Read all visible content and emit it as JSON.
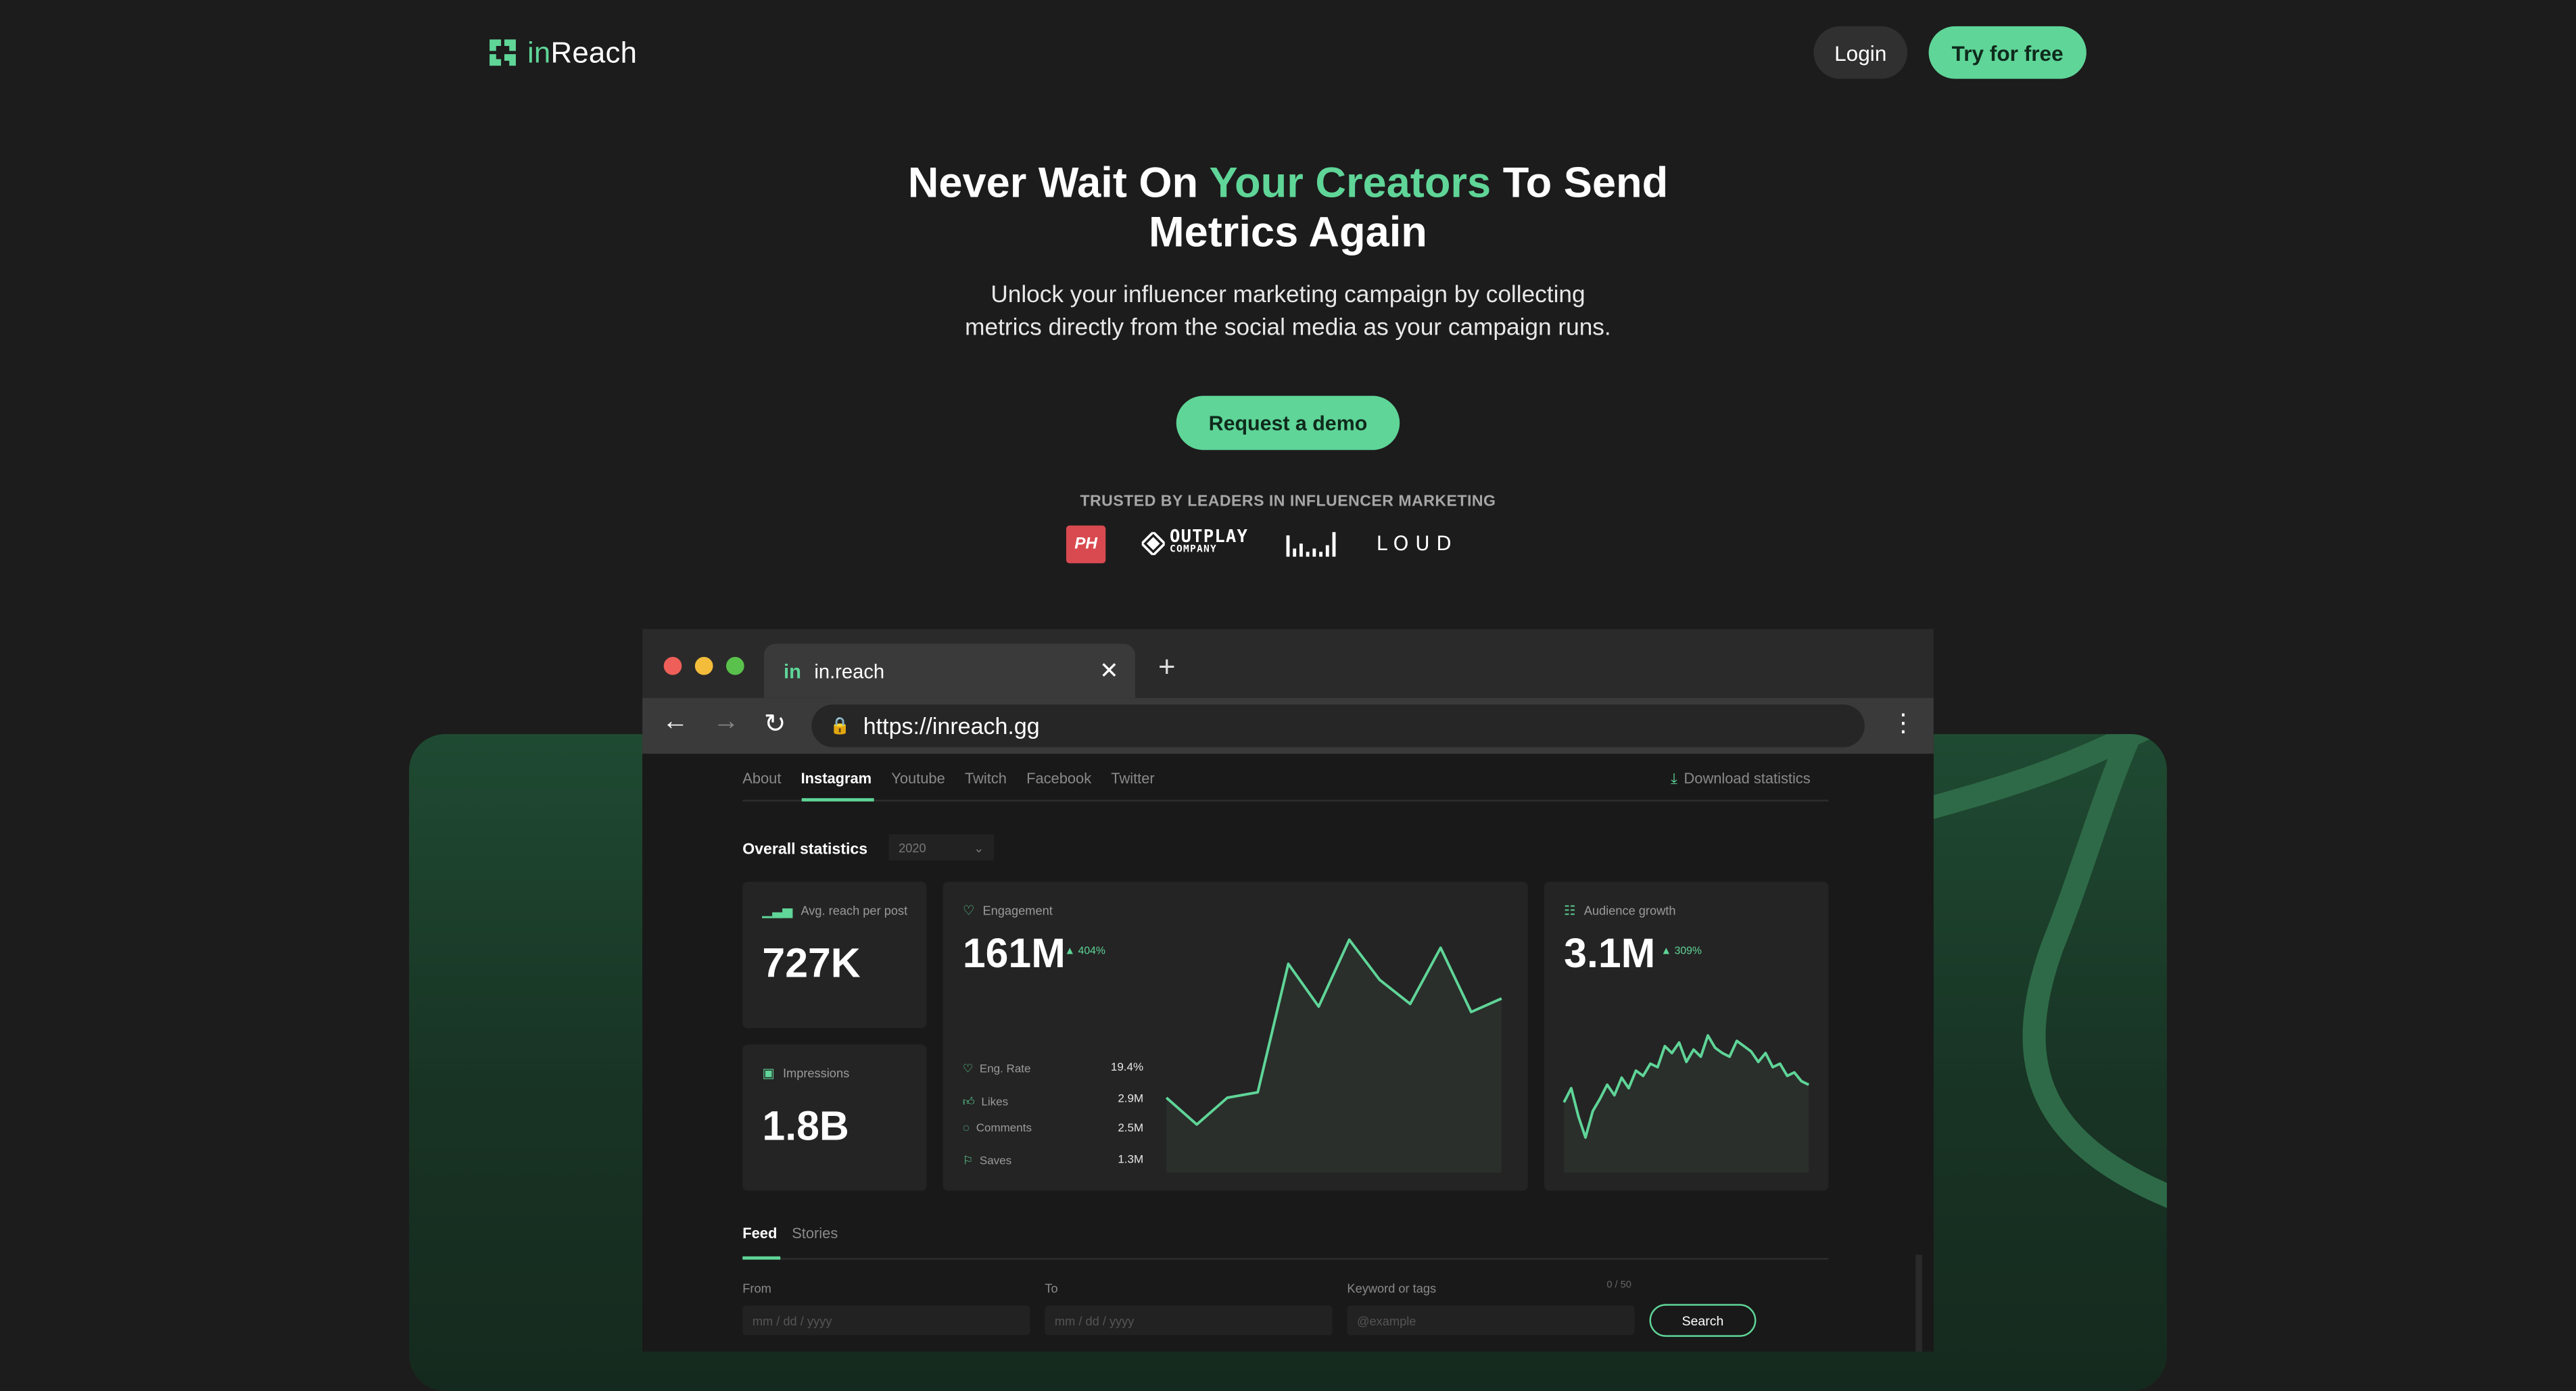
{
  "header": {
    "logo_text_prefix": "in",
    "logo_text_suffix": "Reach",
    "login_label": "Login",
    "try_label": "Try for free"
  },
  "hero": {
    "title_part1": "Never Wait On ",
    "title_accent": "Your Creators",
    "title_part2": " To Send Metrics Again",
    "subtitle": "Unlock your influencer marketing campaign by collecting metrics directly from the social media as your campaign runs.",
    "cta_label": "Request a demo",
    "trusted_label": "TRUSTED BY LEADERS IN INFLUENCER MARKETING"
  },
  "brands": {
    "ph": "PH",
    "outplay_line1": "OUTPLAY",
    "outplay_line2": "COMPANY",
    "loud": "LOUD"
  },
  "colors": {
    "accent": "#5fd598",
    "background": "#1c1c1c",
    "panel_green": "#1f4a32",
    "brand_red": "#d94a50"
  },
  "browser": {
    "tab_favicon": "in",
    "tab_title": "in.reach",
    "url": "https://inreach.gg"
  },
  "dashboard": {
    "tabs": [
      {
        "label": "About"
      },
      {
        "label": "Instagram"
      },
      {
        "label": "Youtube"
      },
      {
        "label": "Twitch"
      },
      {
        "label": "Facebook"
      },
      {
        "label": "Twitter"
      }
    ],
    "active_tab": "Instagram",
    "download_label": "Download statistics",
    "overall_label": "Overall statistics",
    "year_value": "2020",
    "avg_reach": {
      "label": "Avg. reach per post",
      "value": "727K"
    },
    "impressions": {
      "label": "Impressions",
      "value": "1.8B"
    },
    "engagement": {
      "label": "Engagement",
      "value": "161M",
      "delta": "404%",
      "stats": [
        {
          "icon": "heart-icon",
          "label": "Eng. Rate",
          "value": "19.4%"
        },
        {
          "icon": "thumbs-up-icon",
          "label": "Likes",
          "value": "2.9M"
        },
        {
          "icon": "comment-icon",
          "label": "Comments",
          "value": "2.5M"
        },
        {
          "icon": "bookmark-icon",
          "label": "Saves",
          "value": "1.3M"
        }
      ]
    },
    "audience": {
      "label": "Audience growth",
      "value": "3.1M",
      "delta": "309%"
    },
    "feed_tabs": [
      {
        "label": "Feed"
      },
      {
        "label": "Stories"
      }
    ],
    "filters": {
      "from_label": "From",
      "from_placeholder": "mm / dd / yyyy",
      "to_label": "To",
      "to_placeholder": "mm / dd / yyyy",
      "keyword_label": "Keyword or tags",
      "keyword_placeholder": "@example",
      "keyword_count": "0 / 50",
      "search_label": "Search"
    }
  },
  "chart_data": [
    {
      "type": "area",
      "series": [
        {
          "values": [
            28,
            18,
            28,
            30,
            78,
            62,
            87,
            72,
            63,
            84,
            60,
            65
          ]
        }
      ],
      "ylim": [
        0,
        100
      ]
    },
    {
      "type": "line",
      "series": [
        {
          "values": [
            40,
            48,
            32,
            20,
            35,
            42,
            50,
            44,
            54,
            48,
            58,
            55,
            62,
            60,
            72,
            68,
            74,
            63,
            70,
            66,
            78,
            71,
            68,
            66,
            75,
            72,
            69,
            63,
            68,
            60,
            62,
            55,
            57,
            52,
            50
          ]
        }
      ],
      "ylim": [
        0,
        100
      ]
    }
  ]
}
